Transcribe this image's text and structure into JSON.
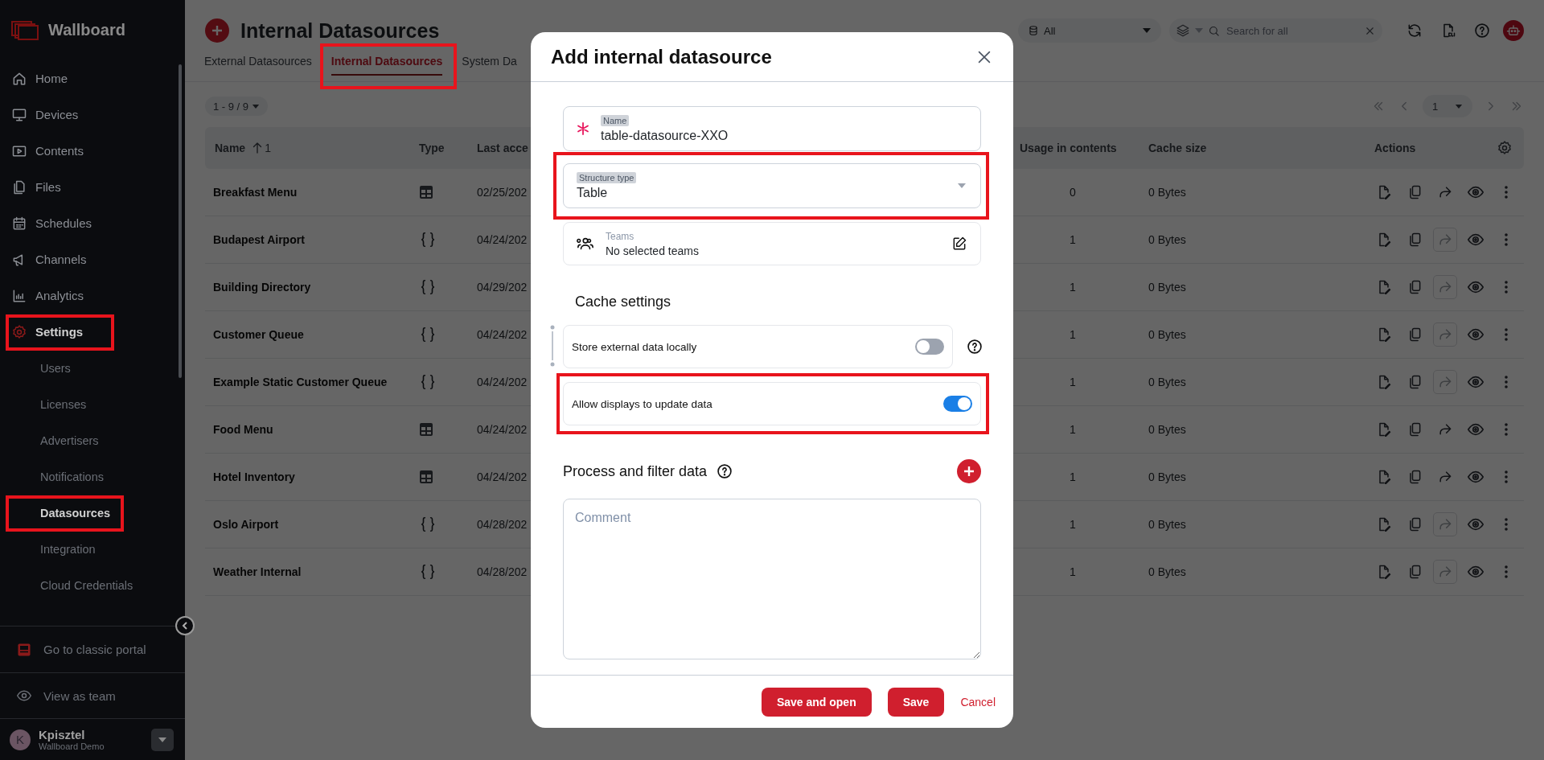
{
  "sidebar": {
    "brand": "Wallboard",
    "items": [
      {
        "label": "Home",
        "selected": false,
        "highlighted": false
      },
      {
        "label": "Devices",
        "selected": false,
        "highlighted": false
      },
      {
        "label": "Contents",
        "selected": false,
        "highlighted": false
      },
      {
        "label": "Files",
        "selected": false,
        "highlighted": false
      },
      {
        "label": "Schedules",
        "selected": false,
        "highlighted": false
      },
      {
        "label": "Channels",
        "selected": false,
        "highlighted": false
      },
      {
        "label": "Analytics",
        "selected": false,
        "highlighted": false
      },
      {
        "label": "Settings",
        "selected": true,
        "highlighted": true,
        "children": [
          {
            "label": "Users",
            "selected": false,
            "highlighted": false
          },
          {
            "label": "Licenses",
            "selected": false,
            "highlighted": false
          },
          {
            "label": "Advertisers",
            "selected": false,
            "highlighted": false
          },
          {
            "label": "Notifications",
            "selected": false,
            "highlighted": false
          },
          {
            "label": "Datasources",
            "selected": true,
            "highlighted": true
          },
          {
            "label": "Integration",
            "selected": false,
            "highlighted": false
          },
          {
            "label": "Cloud Credentials",
            "selected": false,
            "highlighted": false
          }
        ]
      }
    ],
    "footer_items": [
      "Go to classic portal",
      "View as team"
    ],
    "user": {
      "initial": "K",
      "name": "Kpisztel",
      "org": "Wallboard Demo"
    }
  },
  "header": {
    "title": "Internal Datasources",
    "filter": {
      "value": "All"
    },
    "search": {
      "placeholder": "Search for all"
    }
  },
  "tabs": [
    {
      "label": "External Datasources",
      "selected": false,
      "highlighted": false
    },
    {
      "label": "Internal Datasources",
      "selected": true,
      "highlighted": true
    },
    {
      "label": "System Da",
      "selected": false,
      "highlighted": false
    }
  ],
  "pagination": {
    "range": "1 - 9 / 9",
    "page": "1"
  },
  "table": {
    "columns": [
      "Name",
      "Type",
      "Last acce",
      "Usage in contents",
      "Cache size",
      "Actions"
    ],
    "sort_rank": "1",
    "rows": [
      {
        "name": "Breakfast Menu",
        "kind": "table",
        "last_access": "02/25/202",
        "usage": "0",
        "cache": "0 Bytes",
        "share_enabled": true
      },
      {
        "name": "Budapest Airport",
        "kind": "json",
        "last_access": "04/24/202",
        "usage": "1",
        "cache": "0 Bytes",
        "share_enabled": false
      },
      {
        "name": "Building Directory",
        "kind": "json",
        "last_access": "04/29/202",
        "usage": "1",
        "cache": "0 Bytes",
        "share_enabled": false
      },
      {
        "name": "Customer Queue",
        "kind": "json",
        "last_access": "04/24/202",
        "usage": "1",
        "cache": "0 Bytes",
        "share_enabled": false
      },
      {
        "name": "Example Static Customer Queue",
        "kind": "json",
        "last_access": "04/24/202",
        "usage": "1",
        "cache": "0 Bytes",
        "share_enabled": false
      },
      {
        "name": "Food Menu",
        "kind": "table",
        "last_access": "04/24/202",
        "usage": "1",
        "cache": "0 Bytes",
        "share_enabled": true
      },
      {
        "name": "Hotel Inventory",
        "kind": "table",
        "last_access": "04/24/202",
        "usage": "1",
        "cache": "0 Bytes",
        "share_enabled": true
      },
      {
        "name": "Oslo Airport",
        "kind": "json",
        "last_access": "04/28/202",
        "usage": "1",
        "cache": "0 Bytes",
        "share_enabled": false
      },
      {
        "name": "Weather Internal",
        "kind": "json",
        "last_access": "04/28/202",
        "usage": "1",
        "cache": "0 Bytes",
        "share_enabled": false
      }
    ]
  },
  "modal": {
    "title": "Add internal datasource",
    "name_field": {
      "label": "Name",
      "value": "table-datasource-XXO",
      "required": true
    },
    "structure_field": {
      "label": "Structure type",
      "value": "Table",
      "highlighted": true
    },
    "teams_field": {
      "label": "Teams",
      "value": "No selected teams"
    },
    "cache": {
      "heading": "Cache settings",
      "options": [
        {
          "label": "Store external data locally",
          "on": false,
          "help": true,
          "highlighted": false
        },
        {
          "label": "Allow displays to update data",
          "on": true,
          "help": false,
          "highlighted": true
        }
      ]
    },
    "process": {
      "heading": "Process and filter data"
    },
    "comment": {
      "placeholder": "Comment"
    },
    "buttons": [
      {
        "label": "Save and open",
        "kind": "primary"
      },
      {
        "label": "Save",
        "kind": "primary"
      },
      {
        "label": "Cancel",
        "kind": "link"
      }
    ]
  }
}
